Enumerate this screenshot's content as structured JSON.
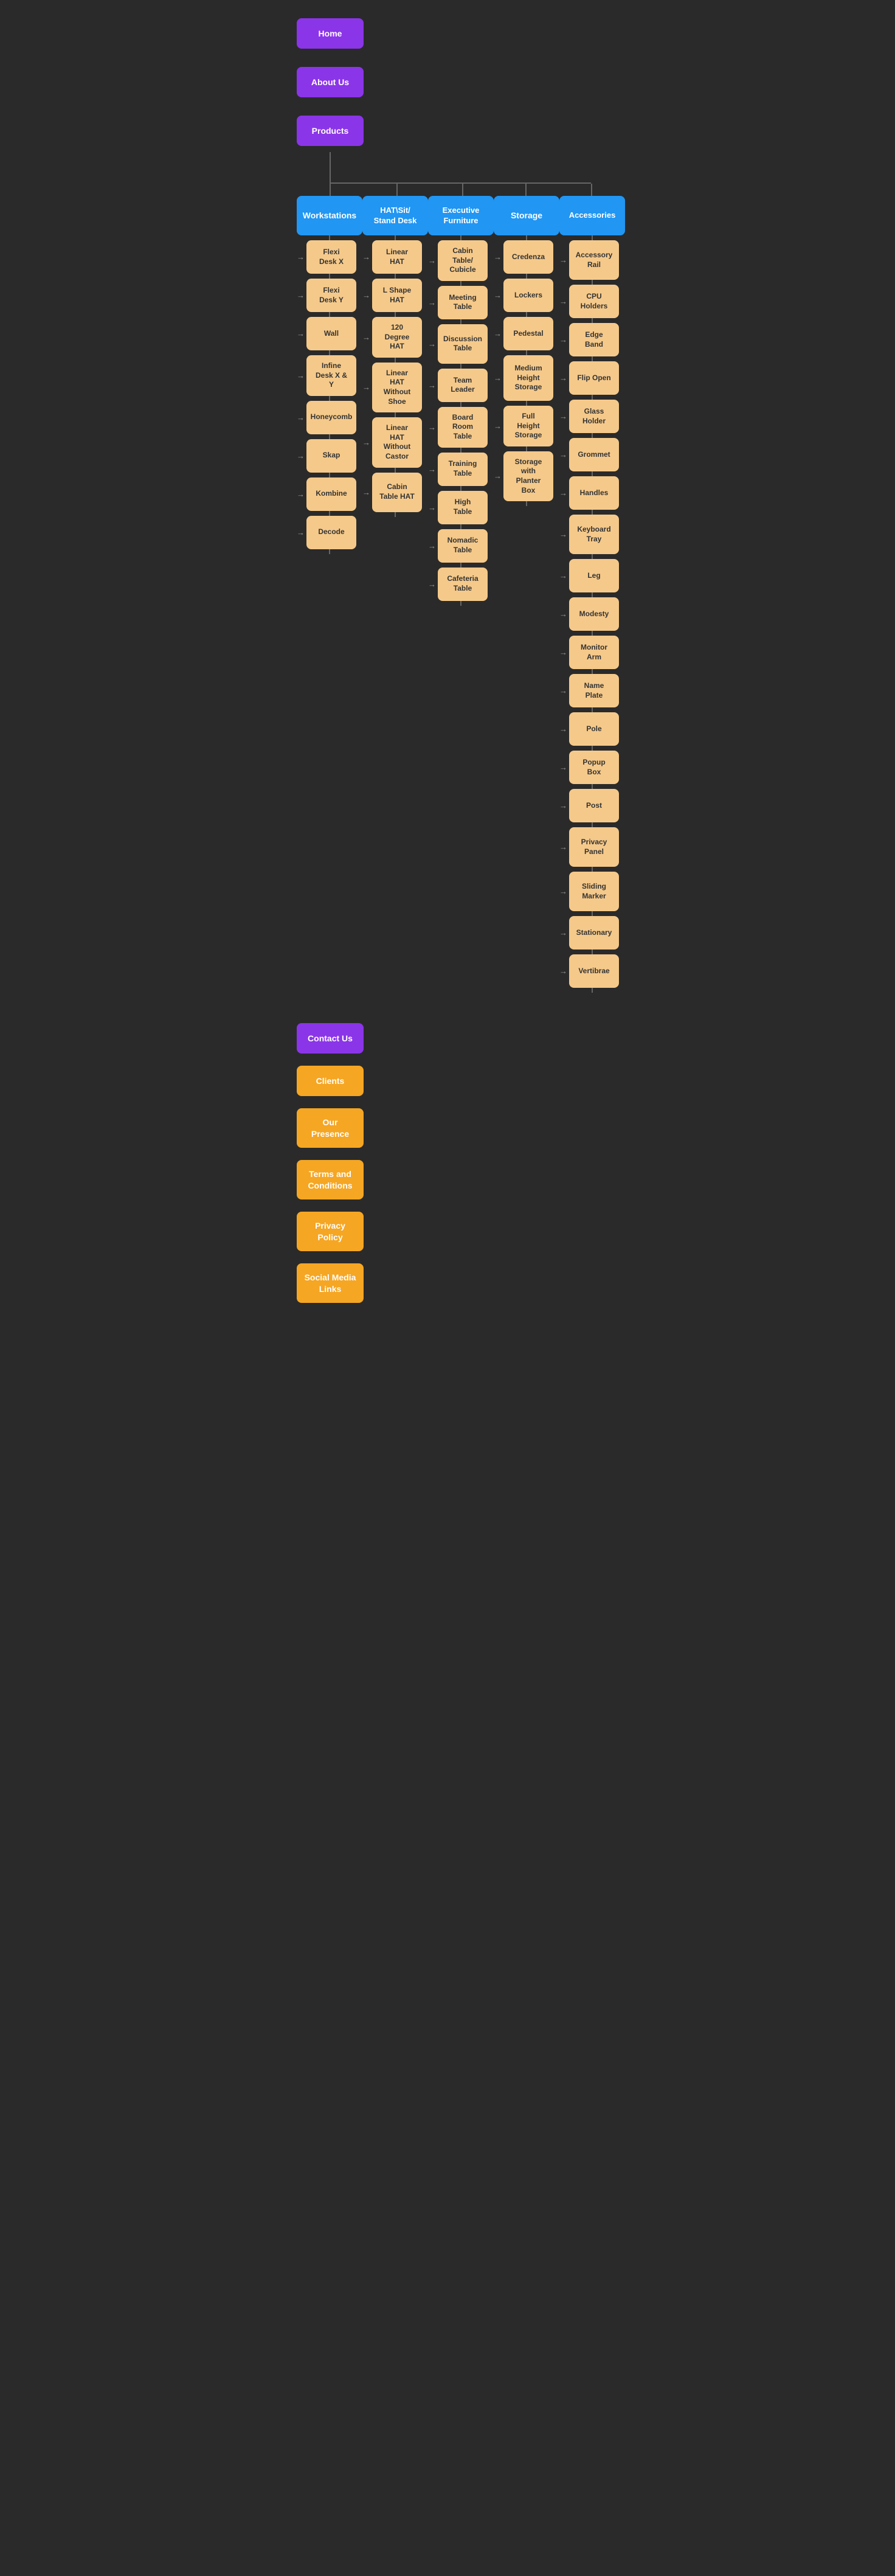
{
  "nav": {
    "home": "Home",
    "about_us": "About Us",
    "products": "Products",
    "contact_us": "Contact Us",
    "clients": "Clients",
    "our_presence": "Our Presence",
    "terms": "Terms and Conditions",
    "privacy": "Privacy Policy",
    "social": "Social Media Links"
  },
  "categories": {
    "workstations": "Workstations",
    "hat_sit_stand": "HAT\\Sit/ Stand Desk",
    "executive": "Executive Furniture",
    "storage": "Storage",
    "accessories": "Accessories"
  },
  "workstations_items": [
    "Flexi Desk X",
    "Flexi Desk Y",
    "Wall",
    "Infine Desk X & Y",
    "Honeycomb",
    "Skap",
    "Kombine",
    "Decode"
  ],
  "hat_items": [
    "Linear HAT",
    "L Shape HAT",
    "120 Degree HAT",
    "Linear HAT Without Shoe",
    "Linear HAT Without Castor",
    "Cabin Table HAT"
  ],
  "executive_items": [
    "Cabin Table/ Cubicle",
    "Meeting Table",
    "Discussion Table",
    "Team Leader",
    "Board Room Table",
    "Training Table",
    "High Table",
    "Nomadic Table",
    "Cafeteria Table"
  ],
  "storage_items": [
    "Credenza",
    "Lockers",
    "Pedestal",
    "Medium Height Storage",
    "Full Height Storage",
    "Storage with Planter Box"
  ],
  "accessories_items": [
    "Accessory Rail",
    "CPU Holders",
    "Edge Band",
    "Flip Open",
    "Glass Holder",
    "Grommet",
    "Handles",
    "Keyboard Tray",
    "Leg",
    "Modesty",
    "Monitor Arm",
    "Name Plate",
    "Pole",
    "Popup Box",
    "Post",
    "Privacy Panel",
    "Sliding Marker",
    "Stationary",
    "Vertibrae"
  ],
  "colors": {
    "bg": "#2a2a2a",
    "purple": "#8b35e8",
    "orange": "#f5a623",
    "blue": "#2196f3",
    "peach": "#f5c98a",
    "line": "#666666",
    "text_dark": "#333333",
    "text_light": "#ffffff"
  }
}
